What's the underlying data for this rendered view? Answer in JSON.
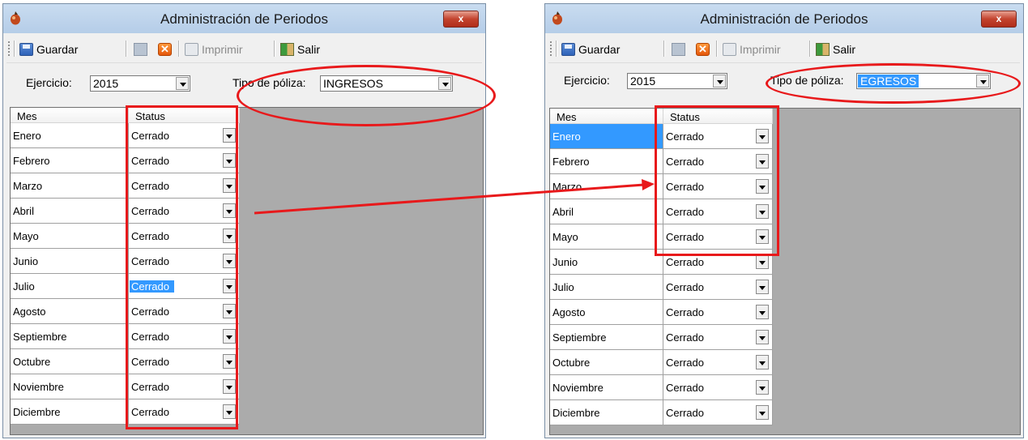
{
  "windows": [
    {
      "id": "left",
      "title": "Administración de Periodos",
      "close_label": "x",
      "toolbar": {
        "save": "Guardar",
        "print": "Imprimir",
        "exit": "Salir"
      },
      "ejercicio_label": "Ejercicio:",
      "ejercicio_value": "2015",
      "tipo_label": "Tipo de póliza:",
      "tipo_value": "INGRESOS",
      "columns": [
        "Mes",
        "Status"
      ],
      "rows": [
        {
          "mes": "Enero",
          "status": "Cerrado"
        },
        {
          "mes": "Febrero",
          "status": "Cerrado"
        },
        {
          "mes": "Marzo",
          "status": "Cerrado"
        },
        {
          "mes": "Abril",
          "status": "Cerrado"
        },
        {
          "mes": "Mayo",
          "status": "Cerrado"
        },
        {
          "mes": "Junio",
          "status": "Cerrado"
        },
        {
          "mes": "Julio",
          "status": "Cerrado"
        },
        {
          "mes": "Agosto",
          "status": "Cerrado"
        },
        {
          "mes": "Septiembre",
          "status": "Cerrado"
        },
        {
          "mes": "Octubre",
          "status": "Cerrado"
        },
        {
          "mes": "Noviembre",
          "status": "Cerrado"
        },
        {
          "mes": "Diciembre",
          "status": "Cerrado"
        }
      ]
    },
    {
      "id": "right",
      "title": "Administración de Periodos",
      "close_label": "x",
      "toolbar": {
        "save": "Guardar",
        "print": "Imprimir",
        "exit": "Salir"
      },
      "ejercicio_label": "Ejercicio:",
      "ejercicio_value": "2015",
      "tipo_label": "Tipo de póliza:",
      "tipo_value": "EGRESOS",
      "columns": [
        "Mes",
        "Status"
      ],
      "rows": [
        {
          "mes": "Enero",
          "status": "Cerrado"
        },
        {
          "mes": "Febrero",
          "status": "Cerrado"
        },
        {
          "mes": "Marzo",
          "status": "Cerrado"
        },
        {
          "mes": "Abril",
          "status": "Cerrado"
        },
        {
          "mes": "Mayo",
          "status": "Cerrado"
        },
        {
          "mes": "Junio",
          "status": "Cerrado"
        },
        {
          "mes": "Julio",
          "status": "Cerrado"
        },
        {
          "mes": "Agosto",
          "status": "Cerrado"
        },
        {
          "mes": "Septiembre",
          "status": "Cerrado"
        },
        {
          "mes": "Octubre",
          "status": "Cerrado"
        },
        {
          "mes": "Noviembre",
          "status": "Cerrado"
        },
        {
          "mes": "Diciembre",
          "status": "Cerrado"
        }
      ]
    }
  ],
  "colors": {
    "annotation": "#e8191b",
    "selection": "#3399ff",
    "grid_background": "#ababab"
  }
}
